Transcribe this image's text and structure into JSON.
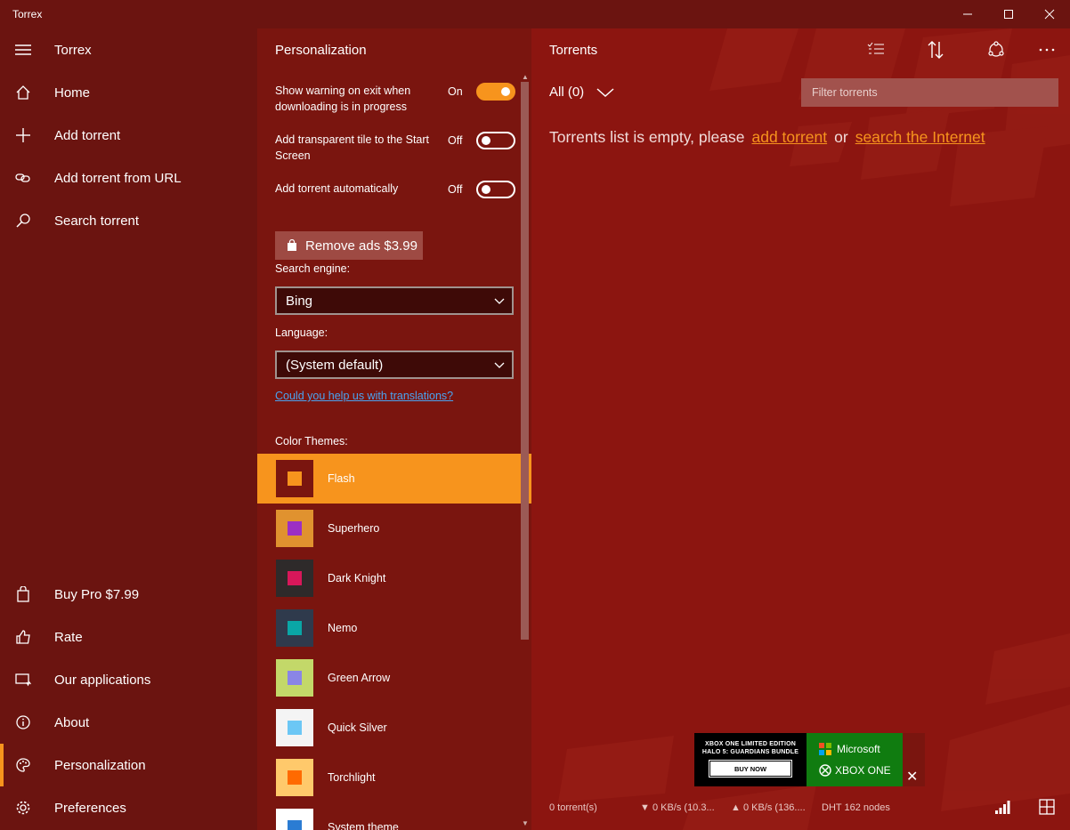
{
  "window": {
    "title": "Torrex"
  },
  "nav": {
    "app_name": "Torrex",
    "items": [
      {
        "label": "Home"
      },
      {
        "label": "Add torrent"
      },
      {
        "label": "Add torrent from URL"
      },
      {
        "label": "Search torrent"
      }
    ],
    "bottom_items": [
      {
        "label": "Buy Pro $7.99"
      },
      {
        "label": "Rate"
      },
      {
        "label": "Our applications"
      },
      {
        "label": "About"
      },
      {
        "label": "Personalization"
      },
      {
        "label": "Preferences"
      }
    ]
  },
  "personalization": {
    "title": "Personalization",
    "settings": [
      {
        "text": "Show warning on exit when downloading is in progress",
        "state": "On",
        "on": true
      },
      {
        "text": "Add transparent tile to the Start Screen",
        "state": "Off",
        "on": false
      },
      {
        "text": "Add torrent automatically",
        "state": "Off",
        "on": false
      }
    ],
    "remove_ads": "Remove ads  $3.99",
    "search_engine_label": "Search engine:",
    "search_engine_value": "Bing",
    "language_label": "Language:",
    "language_value": "(System default)",
    "translation_link": "Could you help us with translations?",
    "themes_label": "Color Themes:",
    "themes": [
      {
        "name": "Flash",
        "outer": "#7a150f",
        "inner": "#f7941d",
        "active": true
      },
      {
        "name": "Superhero",
        "outer": "#e0922f",
        "inner": "#9c2fc4",
        "active": false
      },
      {
        "name": "Dark Knight",
        "outer": "#2e2a2a",
        "inner": "#d8175a",
        "active": false
      },
      {
        "name": "Nemo",
        "outer": "#2f3a4c",
        "inner": "#0aa6a6",
        "active": false
      },
      {
        "name": "Green Arrow",
        "outer": "#c3d869",
        "inner": "#8a85e6",
        "active": false
      },
      {
        "name": "Quick Silver",
        "outer": "#f4f4f4",
        "inner": "#6cc7f5",
        "active": false
      },
      {
        "name": "Torchlight",
        "outer": "#ffc96b",
        "inner": "#ff6a00",
        "active": false
      },
      {
        "name": "System theme",
        "outer": "#ffffff",
        "inner": "#2b7cd3",
        "active": false
      }
    ]
  },
  "torrents": {
    "title": "Torrents",
    "filter_label": "All (0)",
    "filter_placeholder": "Filter torrents",
    "empty_text": "Torrents list is empty, please",
    "add_link": "add torrent",
    "or_text": "or",
    "search_link": "search the Internet"
  },
  "ad": {
    "line1": "XBOX ONE LIMITED EDITION",
    "line2": "HALO 5: GUARDIANS BUNDLE",
    "buy": "BUY NOW",
    "brand": "Microsoft",
    "product": "XBOX ONE",
    "close": "✕"
  },
  "status": {
    "torrents": "0 torrent(s)",
    "down": "▼ 0 KB/s (10.3...",
    "up": "▲ 0 KB/s (136....",
    "dht": "DHT 162 nodes"
  },
  "colors": {
    "accent": "#f7941d",
    "nav_bg": "#6b1410",
    "pane_bg": "#7a150f",
    "main_bg": "#8c1510"
  }
}
